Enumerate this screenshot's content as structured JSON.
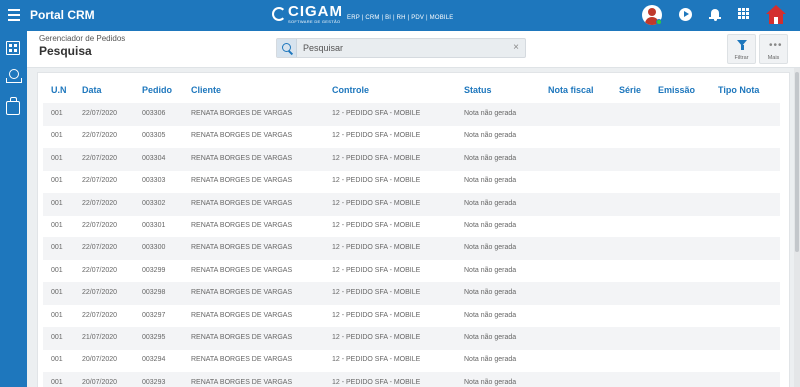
{
  "app": {
    "title": "Portal CRM"
  },
  "brand": {
    "name": "CIGAM",
    "tagline": "SOFTWARE DE GESTÃO",
    "modules": "ERP | CRM | BI | RH | PDV | MOBILE"
  },
  "header": {
    "breadcrumb": "Gerenciador de Pedidos",
    "title": "Pesquisa"
  },
  "search": {
    "placeholder": "Pesquisar",
    "value": "",
    "clear_symbol": "×"
  },
  "toolbar": {
    "filter_label": "Filtrar",
    "more_label": "Mais",
    "more_symbol": "•••"
  },
  "colors": {
    "primary": "#1e77bd",
    "home": "#d32f2f",
    "status_online": "#2ecc40"
  },
  "icons": [
    "menu-icon",
    "play-icon",
    "bell-icon",
    "apps-grid-icon",
    "home-icon",
    "building-icon",
    "money-icon",
    "bag-icon",
    "search-icon",
    "funnel-icon",
    "more-dots-icon"
  ],
  "table": {
    "columns": [
      "U.N",
      "Data",
      "Pedido",
      "Cliente",
      "Controle",
      "Status",
      "Nota fiscal",
      "Série",
      "Emissão",
      "Tipo Nota"
    ],
    "rows": [
      [
        "001",
        "22/07/2020",
        "003306",
        "RENATA BORGES DE VARGAS",
        "12 - PEDIDO SFA - MOBILE",
        "Nota não gerada",
        "",
        "",
        "",
        ""
      ],
      [
        "001",
        "22/07/2020",
        "003305",
        "RENATA BORGES DE VARGAS",
        "12 - PEDIDO SFA - MOBILE",
        "Nota não gerada",
        "",
        "",
        "",
        ""
      ],
      [
        "001",
        "22/07/2020",
        "003304",
        "RENATA BORGES DE VARGAS",
        "12 - PEDIDO SFA - MOBILE",
        "Nota não gerada",
        "",
        "",
        "",
        ""
      ],
      [
        "001",
        "22/07/2020",
        "003303",
        "RENATA BORGES DE VARGAS",
        "12 - PEDIDO SFA - MOBILE",
        "Nota não gerada",
        "",
        "",
        "",
        ""
      ],
      [
        "001",
        "22/07/2020",
        "003302",
        "RENATA BORGES DE VARGAS",
        "12 - PEDIDO SFA - MOBILE",
        "Nota não gerada",
        "",
        "",
        "",
        ""
      ],
      [
        "001",
        "22/07/2020",
        "003301",
        "RENATA BORGES DE VARGAS",
        "12 - PEDIDO SFA - MOBILE",
        "Nota não gerada",
        "",
        "",
        "",
        ""
      ],
      [
        "001",
        "22/07/2020",
        "003300",
        "RENATA BORGES DE VARGAS",
        "12 - PEDIDO SFA - MOBILE",
        "Nota não gerada",
        "",
        "",
        "",
        ""
      ],
      [
        "001",
        "22/07/2020",
        "003299",
        "RENATA BORGES DE VARGAS",
        "12 - PEDIDO SFA - MOBILE",
        "Nota não gerada",
        "",
        "",
        "",
        ""
      ],
      [
        "001",
        "22/07/2020",
        "003298",
        "RENATA BORGES DE VARGAS",
        "12 - PEDIDO SFA - MOBILE",
        "Nota não gerada",
        "",
        "",
        "",
        ""
      ],
      [
        "001",
        "22/07/2020",
        "003297",
        "RENATA BORGES DE VARGAS",
        "12 - PEDIDO SFA - MOBILE",
        "Nota não gerada",
        "",
        "",
        "",
        ""
      ],
      [
        "001",
        "21/07/2020",
        "003295",
        "RENATA BORGES DE VARGAS",
        "12 - PEDIDO SFA - MOBILE",
        "Nota não gerada",
        "",
        "",
        "",
        ""
      ],
      [
        "001",
        "20/07/2020",
        "003294",
        "RENATA BORGES DE VARGAS",
        "12 - PEDIDO SFA - MOBILE",
        "Nota não gerada",
        "",
        "",
        "",
        ""
      ],
      [
        "001",
        "20/07/2020",
        "003293",
        "RENATA BORGES DE VARGAS",
        "12 - PEDIDO SFA - MOBILE",
        "Nota não gerada",
        "",
        "",
        "",
        ""
      ]
    ]
  }
}
